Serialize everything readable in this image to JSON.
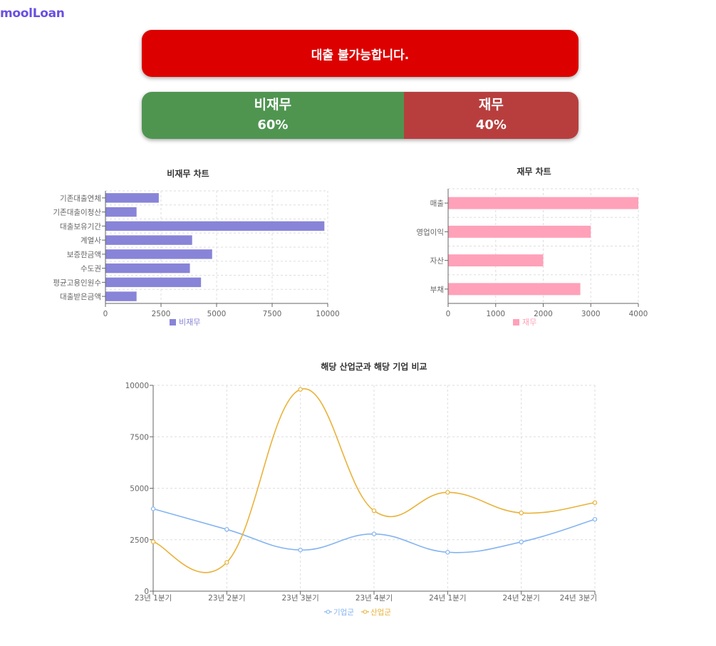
{
  "app": {
    "logo": "moolLoan",
    "logo_color": "#6a4fe0"
  },
  "result": {
    "message": "대출 불가능합니다.",
    "color": "#dd0000"
  },
  "ratio": {
    "segments": [
      {
        "label": "비재무",
        "value_text": "60%",
        "percent": 60,
        "color": "#4f9550"
      },
      {
        "label": "재무",
        "value_text": "40%",
        "percent": 40,
        "color": "#b83e3e"
      }
    ]
  },
  "chart_data": [
    {
      "type": "bar",
      "orientation": "horizontal",
      "title": "비재무 차트",
      "categories": [
        "기존대출연체",
        "기존대출이청산",
        "대출보유기간",
        "계열사",
        "보증한금액",
        "수도권",
        "평균고용인원수",
        "대출받은금액"
      ],
      "series": [
        {
          "name": "비재무",
          "values": [
            2400,
            1400,
            9850,
            3900,
            4800,
            3800,
            4300,
            1400
          ],
          "color": "#8884d8"
        }
      ],
      "xlim": [
        0,
        10000
      ],
      "xticks": [
        0,
        2500,
        5000,
        7500,
        10000
      ],
      "grid": true,
      "legend": "bottom"
    },
    {
      "type": "bar",
      "orientation": "horizontal",
      "title": "재무 차트",
      "categories": [
        "매출",
        "영업이익",
        "자산",
        "부채"
      ],
      "series": [
        {
          "name": "재무",
          "values": [
            4000,
            3000,
            2000,
            2780
          ],
          "color": "#ffa1b9"
        }
      ],
      "xlim": [
        0,
        4000
      ],
      "xticks": [
        0,
        1000,
        2000,
        3000,
        4000
      ],
      "grid": true,
      "legend": "bottom"
    },
    {
      "type": "line",
      "title": "해당 산업군과 해당 기업 비교",
      "categories": [
        "23년 1분기",
        "23년 2분기",
        "23년 3분기",
        "23년 4분기",
        "24년 1분기",
        "24년 2분기",
        "24년 3분기"
      ],
      "series": [
        {
          "name": "기업군",
          "values": [
            4000,
            3000,
            2000,
            2780,
            1890,
            2390,
            3490
          ],
          "color": "#84b4f0"
        },
        {
          "name": "산업군",
          "values": [
            2400,
            1398,
            9800,
            3908,
            4800,
            3800,
            4300
          ],
          "color": "#e9b23a"
        }
      ],
      "ylim": [
        0,
        10000
      ],
      "yticks": [
        0,
        2500,
        5000,
        7500,
        10000
      ],
      "grid": true,
      "legend": "bottom"
    }
  ]
}
